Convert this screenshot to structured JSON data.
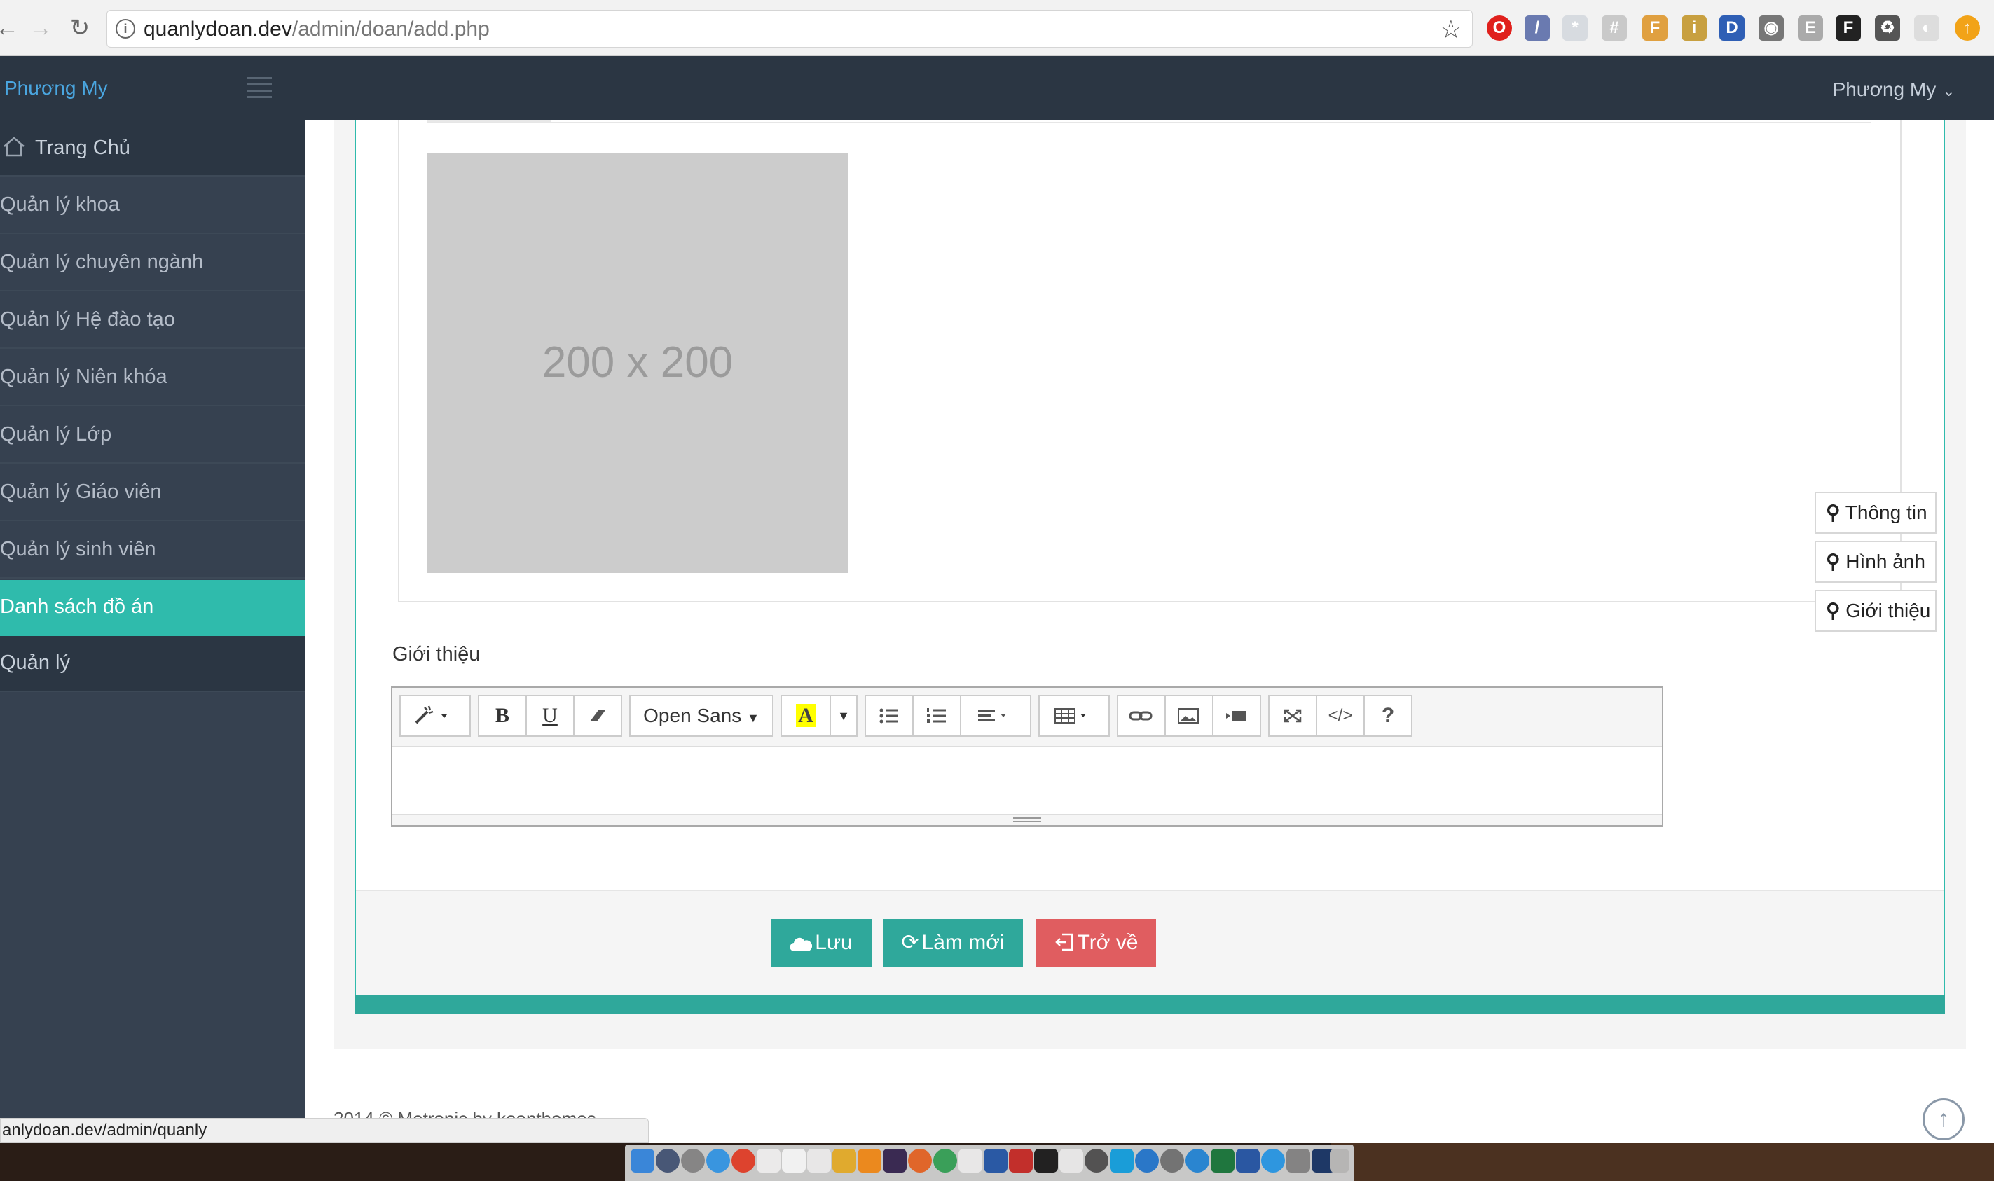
{
  "browser": {
    "url_host": "quanlydoan.dev",
    "url_path": "/admin/doan/add.php"
  },
  "app": {
    "brand": "Phương My",
    "user_name": "Phương My"
  },
  "sidebar": {
    "items": [
      {
        "label": "Trang Chủ"
      },
      {
        "label": "Quản lý khoa"
      },
      {
        "label": "Quản lý chuyên ngành"
      },
      {
        "label": "Quản lý Hệ đào tạo"
      },
      {
        "label": "Quản lý Niên khóa"
      },
      {
        "label": "Quản lý Lớp"
      },
      {
        "label": "Quản lý Giáo viên"
      },
      {
        "label": "Quản lý sinh viên"
      },
      {
        "label": "Danh sách đồ án"
      },
      {
        "label": "Quản lý"
      }
    ]
  },
  "image_placeholder": {
    "text": "200 x 200"
  },
  "intro": {
    "label": "Giới thiệu",
    "toolbar": {
      "bold": "B",
      "underline": "U",
      "font_name": "Open Sans",
      "highlight": "A",
      "help": "?",
      "code": "</>"
    }
  },
  "actions": {
    "save": "Lưu",
    "reset": "Làm mới",
    "back": "Trở về"
  },
  "side_tabs": [
    {
      "label": "Thông tin"
    },
    {
      "label": "Hình ảnh"
    },
    {
      "label": "Giới thiệu"
    }
  ],
  "footer": {
    "text": "2014 © Metronic by keenthemes."
  },
  "status_bar": {
    "link": "anlydoan.dev/admin/quanly"
  },
  "colors": {
    "accent": "#2fa89b",
    "danger": "#e05d60",
    "sidebar_bg": "#364150",
    "topbar_bg": "#2b3643"
  }
}
